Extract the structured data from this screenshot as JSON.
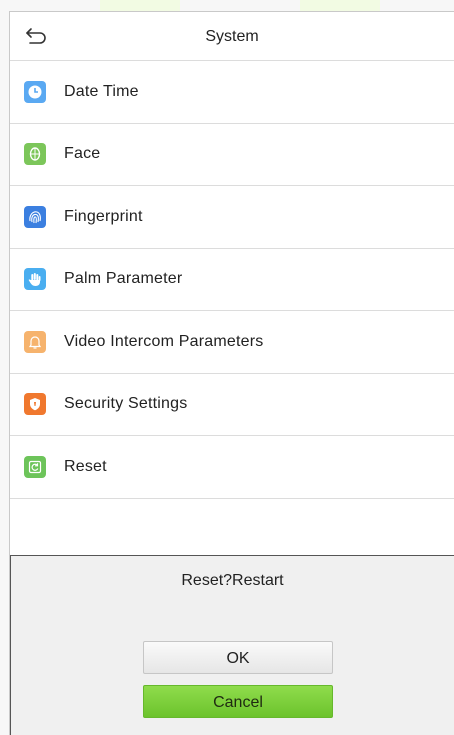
{
  "header": {
    "title": "System",
    "back_icon": "back-arrow-icon"
  },
  "menu": {
    "items": [
      {
        "label": "Date Time",
        "icon": "clock-icon",
        "color": "#5aa9f2"
      },
      {
        "label": "Face",
        "icon": "face-icon",
        "color": "#7cc65a"
      },
      {
        "label": "Fingerprint",
        "icon": "fingerprint-icon",
        "color": "#3b7fe0"
      },
      {
        "label": "Palm Parameter",
        "icon": "palm-icon",
        "color": "#4aaef0"
      },
      {
        "label": "Video Intercom Parameters",
        "icon": "bell-icon",
        "color": "#f6b36d"
      },
      {
        "label": "Security Settings",
        "icon": "shield-icon",
        "color": "#f0782e"
      },
      {
        "label": "Reset",
        "icon": "reset-icon",
        "color": "#6dc45a"
      }
    ]
  },
  "dialog": {
    "message": "Reset?Restart",
    "ok_label": "OK",
    "cancel_label": "Cancel",
    "ok_color": "#ececec",
    "cancel_color": "#7acd3c"
  }
}
